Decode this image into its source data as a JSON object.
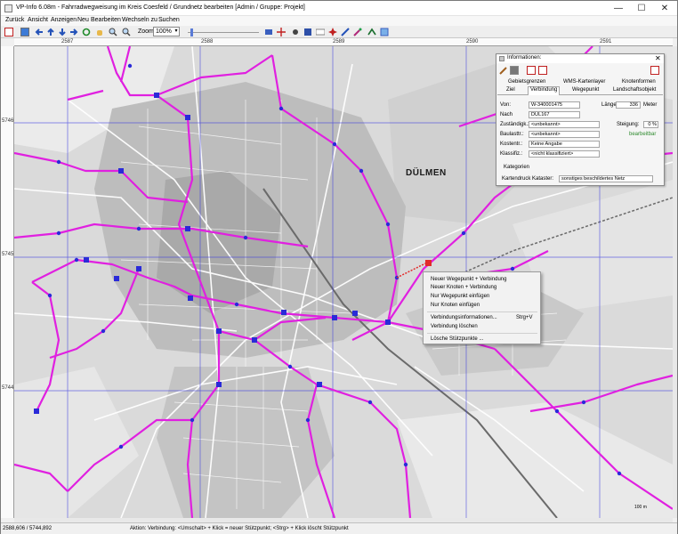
{
  "window": {
    "title": "VP-Info 6.08m - Fahrradwegweisung im Kreis Coesfeld / Grundnetz bearbeiten [Admin / Gruppe: Projekt]",
    "minimize_glyph": "—",
    "maximize_glyph": "☐",
    "close_glyph": "✕"
  },
  "menu": {
    "items": [
      "Zurück",
      "Ansicht",
      "Anzeigen",
      "Neu",
      "Bearbeiten",
      "Wechseln zu ...",
      "Suchen"
    ]
  },
  "toolbar": {
    "zoom_label": "Zoom:",
    "zoom_value": "100%",
    "zoom_arrow": "▾",
    "icons": [
      "back-icon",
      "refresh-icon",
      "arrow-left-icon",
      "arrow-up-icon",
      "arrow-down-icon",
      "arrow-right-icon",
      "rotate-icon",
      "hand-icon",
      "zoom-in-icon",
      "zoom-out-icon",
      "select-icon",
      "crosshair-icon",
      "node-icon",
      "grid-icon",
      "anno-icon",
      "waypoint-icon",
      "link-icon",
      "magic-icon",
      "measure-icon",
      "layer-icon"
    ]
  },
  "rulers": {
    "top": [
      "2587",
      "2588",
      "2589",
      "2590",
      "2591"
    ],
    "left": [
      "5746",
      "5745",
      "5744"
    ]
  },
  "map": {
    "place_label": "DÜLMEN",
    "scale_label": "100 m",
    "colors": {
      "route": "#e020e0",
      "node": "#2a2ad8",
      "grid": "#3a3ae0",
      "highlight": "#e22a2a"
    }
  },
  "info_panel": {
    "title": "Informationen:",
    "close_glyph": "✕",
    "tabs_row1": [
      "Gebietsgrenzen",
      "WMS-Kartenlayer",
      "Knotenformen"
    ],
    "tabs_row2": [
      "Ziel",
      "Verbindung",
      "Wegepunkt",
      "Landschaftsobjekt"
    ],
    "active_tab": "Verbindung",
    "fields": {
      "von_label": "Von:",
      "von_value": "W-340001475",
      "nach_label": "Nach",
      "nach_value": "DÜL167",
      "laenge_label": "Länge:",
      "laenge_value": "336",
      "laenge_unit": "Meter",
      "zustaendig_label": "Zuständigk.:",
      "zustaendig_value": "<unbekannt>",
      "steigung_label": "Steigung:",
      "steigung_value": "0 %",
      "baulasttr_label": "Baulasttr.:",
      "baulasttr_value": "<unbekannt>",
      "status_green": "bearbeitbar",
      "kostentr_label": "Kostentr.:",
      "kostentr_value": "Keine Angabe",
      "klassifiz_label": "Klassifiz.:",
      "klassifiz_value": "<nicht klassifiziert>",
      "kategorien_label": "Kategorien",
      "kartendruck_label": "Kartendruck Kataster:",
      "kartendruck_value": "sonstiges beschildertes Netz"
    }
  },
  "context_menu": {
    "items": [
      "Neuer Wegepunkt + Verbindung",
      "Neuer Knoten + Verbindung",
      "Nur Wegepunkt einfügen",
      "Nur Knoten einfügen",
      "Verbindungsinformationen...",
      "Verbindung löschen",
      "Lösche Stützpunkte ..."
    ],
    "shortcut": "Strg+V"
  },
  "status": {
    "coords": "2588,606 / 5744,892",
    "action": "Aktion: Verbindung: <Umschalt> + Klick = neuer Stützpunkt; <Strg> + Klick löscht Stützpunkt"
  }
}
